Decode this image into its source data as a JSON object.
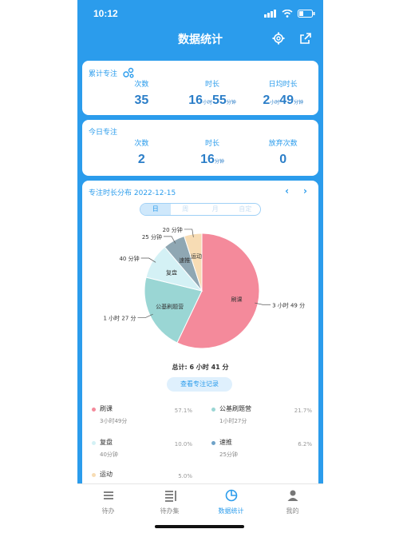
{
  "status": {
    "time": "10:12"
  },
  "header": {
    "title": "数据统计"
  },
  "cumulative": {
    "title": "累计专注",
    "labels": [
      "次数",
      "时长",
      "日均时长"
    ],
    "count": "35",
    "dur_h": "16",
    "dur_h_unit": "小时",
    "dur_m": "55",
    "dur_m_unit": "分钟",
    "avg_h": "2",
    "avg_h_unit": "小时",
    "avg_m": "49",
    "avg_m_unit": "分钟"
  },
  "today": {
    "title": "今日专注",
    "labels": [
      "次数",
      "时长",
      "放弃次数"
    ],
    "count": "2",
    "dur_h": "16",
    "dur_m_unit": "分钟",
    "abandon": "0"
  },
  "distribution": {
    "title": "专注时长分布 2022-12-15",
    "segments": [
      "日",
      "周",
      "月",
      "自定"
    ],
    "total": "总计: 6 小时 41 分",
    "records_button": "查看专注记录"
  },
  "chart_data": {
    "type": "pie",
    "slices": [
      {
        "name": "刷课",
        "value": 57.1,
        "label": "3 小时 49 分",
        "color": "#f48a9b"
      },
      {
        "name": "公基刷题营",
        "value": 21.7,
        "label": "1 小时 27 分",
        "color": "#9ad6d4"
      },
      {
        "name": "复盘",
        "value": 10.0,
        "label": "40 分钟",
        "color": "#d4f1f5"
      },
      {
        "name": "速推",
        "value": 6.2,
        "label": "25 分钟",
        "color": "#8fa7b3"
      },
      {
        "name": "运动",
        "value": 5.0,
        "label": "20 分钟",
        "color": "#f7dcb4"
      }
    ]
  },
  "legend": [
    {
      "name": "刷课",
      "dur": "3小时49分",
      "pct": "57.1%",
      "color": "#f48a9b"
    },
    {
      "name": "公基刷题营",
      "dur": "1小时27分",
      "pct": "21.7%",
      "color": "#9ad6d4"
    },
    {
      "name": "复盘",
      "dur": "40分钟",
      "pct": "10.0%",
      "color": "#d4f1f5"
    },
    {
      "name": "速推",
      "dur": "25分钟",
      "pct": "6.2%",
      "color": "#6fa2c8"
    },
    {
      "name": "运动",
      "dur": "",
      "pct": "5.0%",
      "color": "#f7dcb4"
    }
  ],
  "tabs": [
    "待办",
    "待办集",
    "数据统计",
    "我的"
  ]
}
